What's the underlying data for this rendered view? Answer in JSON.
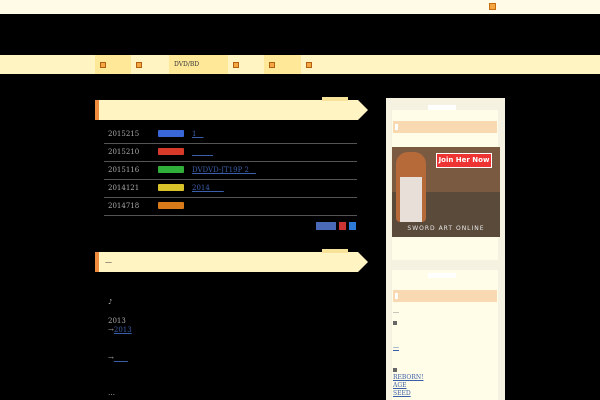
{
  "topbar": {
    "marker_icon": "orange-square-icon"
  },
  "nav": {
    "items": [
      {
        "label": ""
      },
      {
        "label": ""
      },
      {
        "label": "DVD/BD"
      },
      {
        "label": ""
      },
      {
        "label": ""
      },
      {
        "label": ""
      }
    ]
  },
  "news": {
    "heading": "",
    "rows": [
      {
        "date": "2015215",
        "color": "#3a67d8",
        "link": "1　"
      },
      {
        "date": "2015210",
        "color": "#d83a2a",
        "link": "　　　"
      },
      {
        "date": "2015116",
        "color": "#2fae3a",
        "link": "DVDVD-JT19P 2　"
      },
      {
        "date": "2014121",
        "color": "#d8c22a",
        "link": "2014　　"
      },
      {
        "date": "2014718",
        "color": "#d87a1a",
        "link": ""
      }
    ]
  },
  "article": {
    "heading": "—",
    "line1": "♪",
    "line2": "2013",
    "line3_prefix": "→",
    "line3_link": "2013",
    "line4_prefix": "→",
    "line4_link": "　　",
    "line5": "…"
  },
  "sidebar": {
    "ad_button": "Join Her Now",
    "ad_logo": "SWORD ART ONLINE",
    "text1": "…",
    "text2": "—",
    "text3": "　",
    "links": [
      "REBORN!",
      "AGE",
      "SEED"
    ]
  }
}
